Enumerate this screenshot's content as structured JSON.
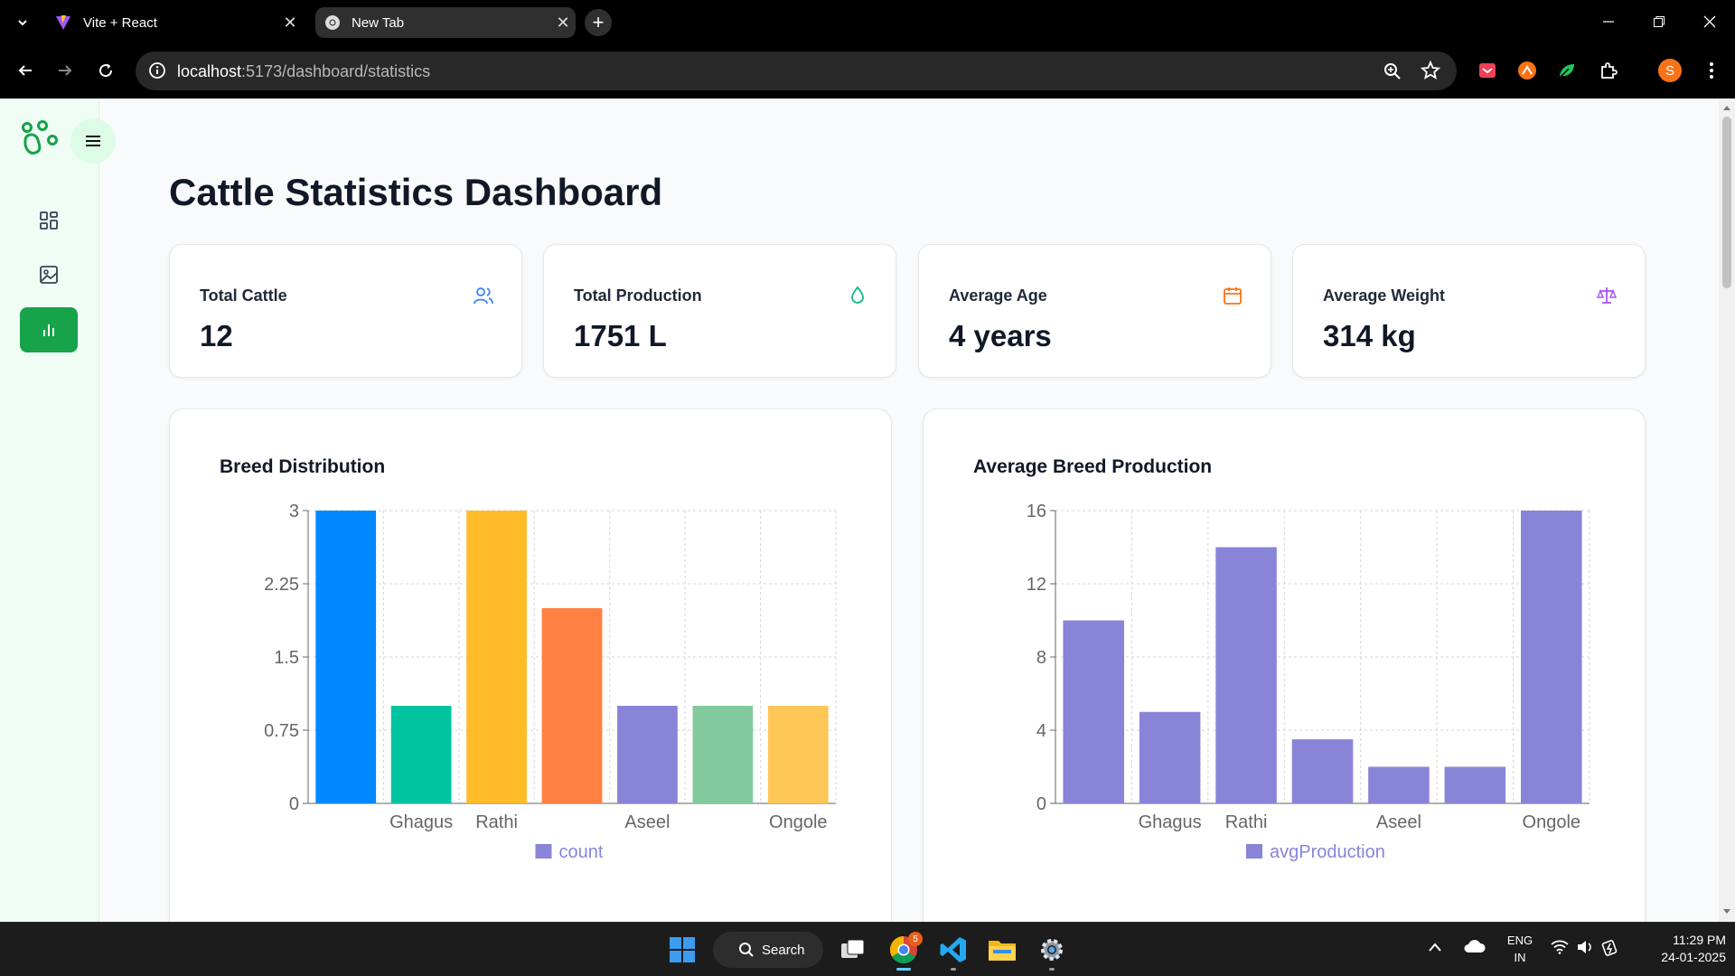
{
  "browser": {
    "tabs": [
      {
        "title": "Vite + React",
        "active": false,
        "icon": "vite-icon"
      },
      {
        "title": "New Tab",
        "active": true,
        "icon": "chrome-icon"
      }
    ],
    "url_host": "localhost",
    "url_path": ":5173/dashboard/statistics",
    "profile_initial": "S"
  },
  "page": {
    "title": "Cattle Statistics Dashboard"
  },
  "sidebar": {
    "items": [
      {
        "icon": "grid-icon",
        "active": false
      },
      {
        "icon": "image-icon",
        "active": false
      },
      {
        "icon": "bar-chart-icon",
        "active": true
      }
    ]
  },
  "stats": [
    {
      "label": "Total Cattle",
      "value": "12",
      "icon": "users-icon",
      "color": "#3b82f6"
    },
    {
      "label": "Total Production",
      "value": "1751 L",
      "icon": "droplet-icon",
      "color": "#10b981"
    },
    {
      "label": "Average Age",
      "value": "4 years",
      "icon": "calendar-icon",
      "color": "#f97316"
    },
    {
      "label": "Average Weight",
      "value": "314 kg",
      "icon": "scale-icon",
      "color": "#a855f7"
    }
  ],
  "chart_data": [
    {
      "type": "bar",
      "title": "Breed Distribution",
      "categories": [
        "",
        "Ghagus",
        "Rathi",
        "",
        "Aseel",
        "",
        "Ongole"
      ],
      "series": [
        {
          "name": "count",
          "values": [
            3,
            1,
            3,
            2,
            1,
            1,
            1
          ]
        }
      ],
      "bar_colors": [
        "#0088FE",
        "#00C49F",
        "#FFBB28",
        "#FF8042",
        "#8884d8",
        "#82ca9d",
        "#ffc658"
      ],
      "legend_color": "#8884d8",
      "yticks": [
        "0",
        "0.75",
        "1.5",
        "2.25",
        "3"
      ],
      "ylim": [
        0,
        3
      ],
      "grid": true,
      "legend": "bottom"
    },
    {
      "type": "bar",
      "title": "Average Breed Production",
      "categories": [
        "",
        "Ghagus",
        "Rathi",
        "",
        "Aseel",
        "",
        "Ongole"
      ],
      "series": [
        {
          "name": "avgProduction",
          "values": [
            10,
            5,
            14,
            3.5,
            2,
            2,
            16
          ]
        }
      ],
      "bar_colors": [
        "#8884d8",
        "#8884d8",
        "#8884d8",
        "#8884d8",
        "#8884d8",
        "#8884d8",
        "#8884d8"
      ],
      "legend_color": "#8884d8",
      "yticks": [
        "0",
        "4",
        "8",
        "12",
        "16"
      ],
      "ylim": [
        0,
        16
      ],
      "grid": true,
      "legend": "bottom"
    }
  ],
  "taskbar": {
    "search_label": "Search",
    "chrome_badge": "5",
    "lang_line1": "ENG",
    "lang_line2": "IN",
    "time": "11:29 PM",
    "date": "24-01-2025"
  }
}
